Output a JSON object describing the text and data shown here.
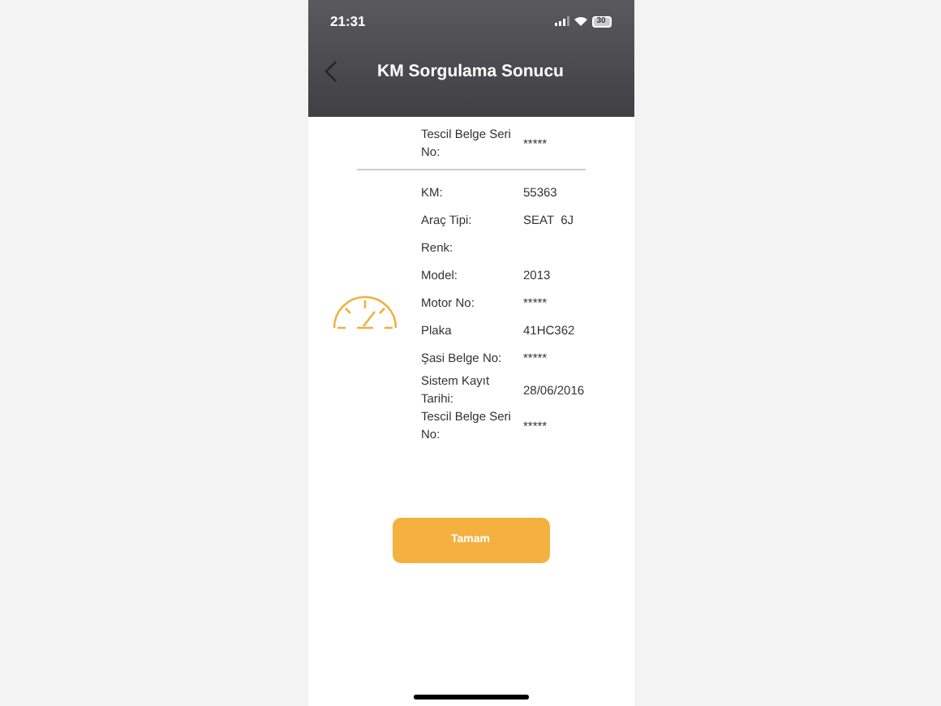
{
  "status_bar": {
    "time": "21:31",
    "battery": "30"
  },
  "header": {
    "title": "KM Sorgulama Sonucu"
  },
  "top_row": {
    "label": "Tescil Belge Seri No:",
    "value": "*****"
  },
  "rows": [
    {
      "label": "KM:",
      "value": "55363"
    },
    {
      "label": "Araç Tipi:",
      "value": "SEAT  6J"
    },
    {
      "label": "Renk:"
    },
    {
      "label": "Model:",
      "value": "2013"
    },
    {
      "label": "Motor No:",
      "value": "*****"
    },
    {
      "label": "Plaka",
      "value": "41HC362"
    },
    {
      "label": "Şasi Belge No:",
      "value": "*****"
    },
    {
      "label": "Sistem Kayıt Tarihi:",
      "value": "28/06/2016"
    },
    {
      "label": "Tescil Belge Seri No:",
      "value": "*****"
    }
  ],
  "button": {
    "label": "Tamam"
  }
}
